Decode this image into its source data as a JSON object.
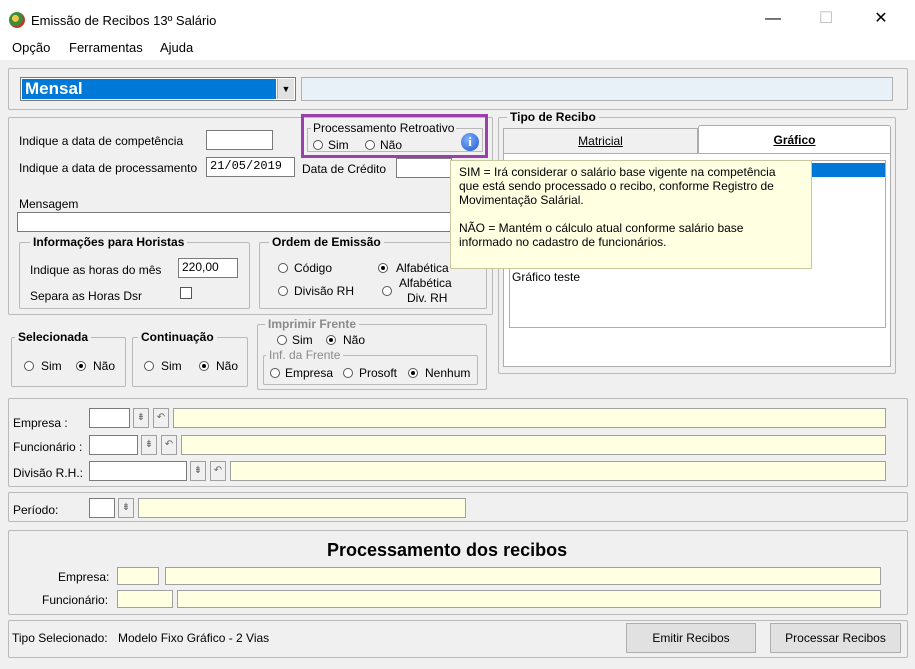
{
  "window": {
    "title": "Emissão de Recibos 13º Salário",
    "minimize": "—",
    "maximize": "☐",
    "close": "✕"
  },
  "menu": [
    "Opção",
    "Ferramentas",
    "Ajuda"
  ],
  "top": {
    "dropdown_value": "Mensal"
  },
  "form": {
    "competencia_label": "Indique a data de competência",
    "processamento_label": "Indique a data de processamento",
    "processamento_value": "21/05/2019",
    "credito_label": "Data de Crédito",
    "mensagem_label": "Mensagem"
  },
  "retroativo": {
    "title": "Processamento Retroativo",
    "sim": "Sim",
    "nao": "Não"
  },
  "horistas": {
    "title": "Informações para Horistas",
    "horas_label": "Indique as horas do mês",
    "horas_value": "220,00",
    "dsr_label": "Separa as Horas Dsr"
  },
  "ordem": {
    "title": "Ordem de Emissão",
    "codigo": "Código",
    "alfabetica": "Alfabética",
    "divisao": "Divisão RH",
    "alf_div_1": "Alfabética",
    "alf_div_2": "Div. RH"
  },
  "selecionada": {
    "title": "Selecionada",
    "sim": "Sim",
    "nao": "Não"
  },
  "continuacao": {
    "title": "Continuação",
    "sim": "Sim",
    "nao": "Não"
  },
  "imprimir": {
    "title": "Imprimir Frente",
    "sim": "Sim",
    "nao": "Não",
    "inf_title": "Inf. da Frente",
    "empresa": "Empresa",
    "prosoft": "Prosoft",
    "nenhum": "Nenhum"
  },
  "tipo_recibo": {
    "title": "Tipo de Recibo",
    "tab_matricial": "Matricial",
    "tab_grafico": "Gráfico",
    "list_item": "Gráfico teste"
  },
  "tooltip": {
    "line1": "SIM = Irá considerar o salário base vigente na competência",
    "line2": "que está sendo processado o recibo, conforme Registro de",
    "line3": "Movimentação Salárial.",
    "line4": "NÃO = Mantém o cálculo atual conforme salário base",
    "line5": "informado no cadastro de funcionários."
  },
  "filters": {
    "empresa": "Empresa :",
    "funcionario": "Funcionário :",
    "divisao": "Divisão R.H.:",
    "periodo": "Período:"
  },
  "processamento": {
    "title": "Processamento dos recibos",
    "empresa": "Empresa:",
    "funcionario": "Funcionário:"
  },
  "footer": {
    "tipo_label": "Tipo Selecionado:",
    "tipo_value": "Modelo Fixo Gráfico - 2 Vias",
    "emitir": "Emitir Recibos",
    "processar": "Processar Recibos"
  },
  "icons": {
    "info": "info-icon",
    "app": "app-icon"
  }
}
